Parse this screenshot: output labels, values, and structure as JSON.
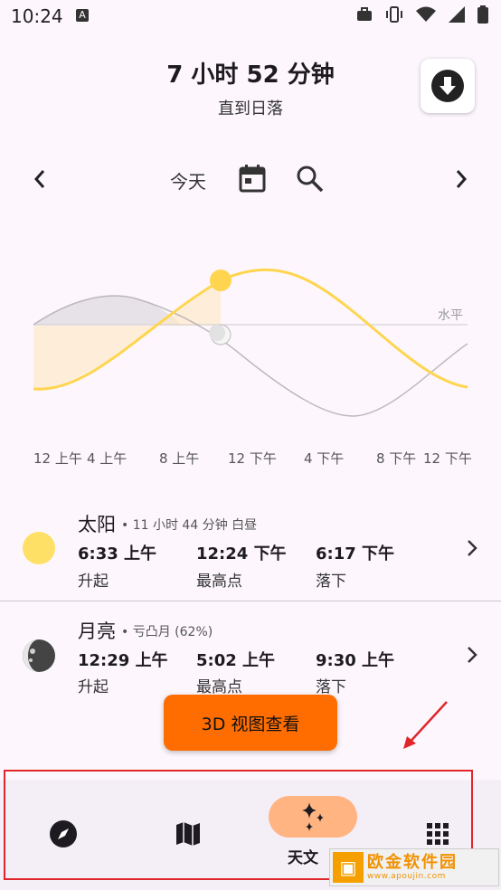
{
  "status_bar": {
    "time": "10:24",
    "icons": [
      "a-badge-icon",
      "briefcase-icon",
      "vibrate-icon",
      "wifi-icon",
      "signal-icon",
      "battery-icon"
    ]
  },
  "header": {
    "title": "7 小时 52 分钟",
    "subtitle": "直到日落"
  },
  "date_nav": {
    "label": "今天"
  },
  "chart": {
    "horizon_label": "水平",
    "x_ticks": [
      "12 上午",
      "4 上午",
      "8 上午",
      "12 下午",
      "4 下午",
      "8 下午",
      "12 下午"
    ]
  },
  "sun": {
    "name": "太阳",
    "meta": "11 小时 44 分钟 白昼",
    "rise_time": "6:33 上午",
    "rise_label": "升起",
    "peak_time": "12:24 下午",
    "peak_label": "最高点",
    "set_time": "6:17 下午",
    "set_label": "落下",
    "color": "#ffe066"
  },
  "moon": {
    "name": "月亮",
    "meta": "亏凸月 (62%)",
    "rise_time": "12:29 上午",
    "rise_label": "升起",
    "peak_time": "5:02 上午",
    "peak_label": "最高点",
    "set_time": "9:30 上午",
    "set_label": "落下"
  },
  "action_button": {
    "label": "3D 视图查看",
    "color": "#ff6d00"
  },
  "bottom_nav": {
    "active_label": "天文",
    "items": [
      "compass-icon",
      "map-icon",
      "sparkle-icon",
      "grid-icon"
    ]
  },
  "watermark": {
    "title": "欧金软件园",
    "url": "www.apoujin.com"
  },
  "colors": {
    "background": "#fdf7fd",
    "accent_pill": "#ffb482",
    "sun_curve": "#ffd54f",
    "annotation": "#e0262b"
  }
}
